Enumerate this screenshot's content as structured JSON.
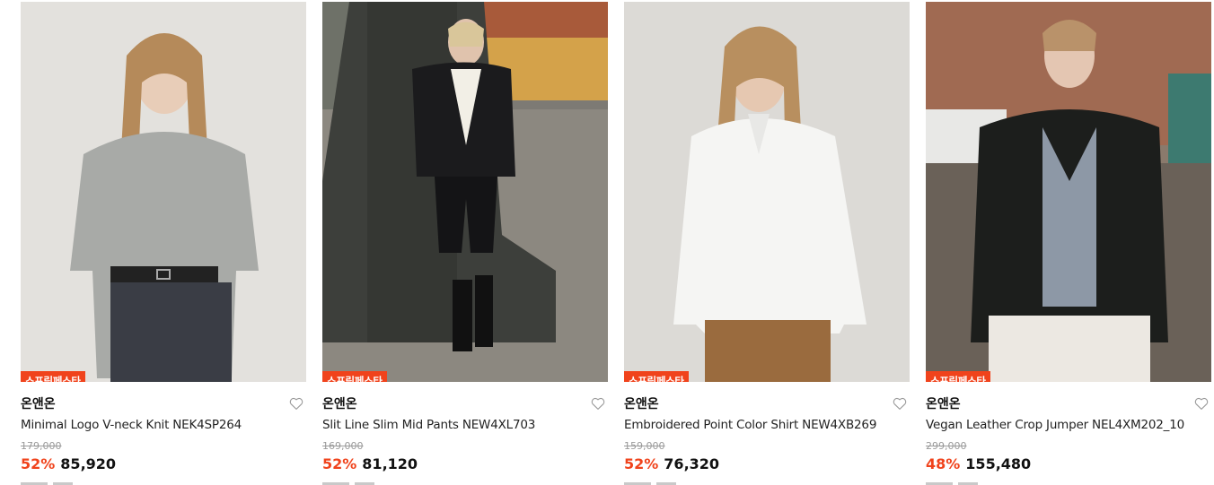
{
  "colors": {
    "accent": "#f0431c",
    "badge_bg": "#f0431c",
    "text": "#111111",
    "muted": "#9a9a9a"
  },
  "products": [
    {
      "badge": "스프링페스타",
      "brand": "온앤온",
      "name": "Minimal Logo V-neck Knit NEK4SP264",
      "original_price": "179,000",
      "discount": "52%",
      "price": "85,920",
      "wishlist_icon": "heart-outline-icon"
    },
    {
      "badge": "스프링페스타",
      "brand": "온앤온",
      "name": "Slit Line Slim Mid Pants NEW4XL703",
      "original_price": "169,000",
      "discount": "52%",
      "price": "81,120",
      "wishlist_icon": "heart-outline-icon"
    },
    {
      "badge": "스프링페스타",
      "brand": "온앤온",
      "name": "Embroidered Point Color Shirt NEW4XB269",
      "original_price": "159,000",
      "discount": "52%",
      "price": "76,320",
      "wishlist_icon": "heart-outline-icon"
    },
    {
      "badge": "스프링페스타",
      "brand": "온앤온",
      "name": "Vegan Leather Crop Jumper NEL4XM202_10",
      "original_price": "299,000",
      "discount": "48%",
      "price": "155,480",
      "wishlist_icon": "heart-outline-icon"
    }
  ]
}
